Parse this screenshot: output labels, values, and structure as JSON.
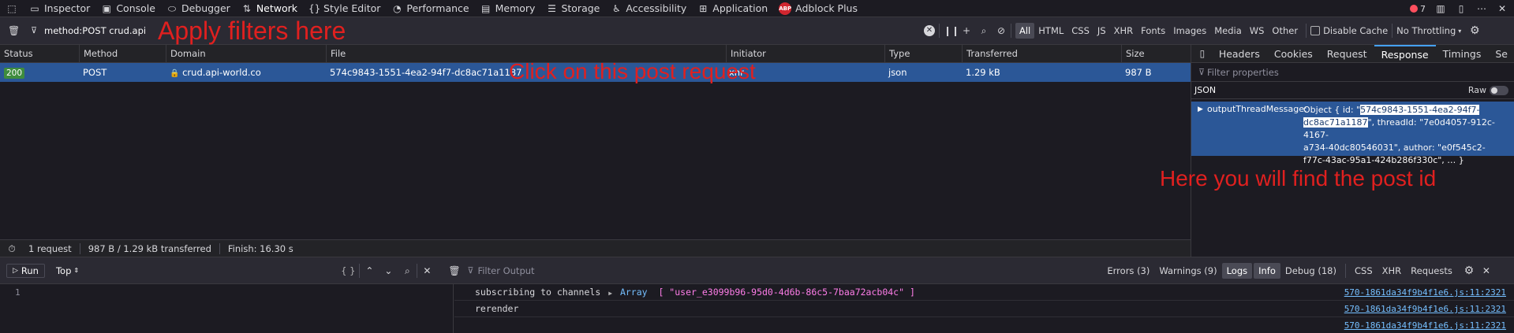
{
  "toolbox": {
    "tabs": [
      {
        "label": "Inspector",
        "icon": "inspector-icon"
      },
      {
        "label": "Console",
        "icon": "console-icon"
      },
      {
        "label": "Debugger",
        "icon": "debugger-icon"
      },
      {
        "label": "Network",
        "icon": "network-icon"
      },
      {
        "label": "Style Editor",
        "icon": "style-editor-icon"
      },
      {
        "label": "Performance",
        "icon": "performance-icon"
      },
      {
        "label": "Memory",
        "icon": "memory-icon"
      },
      {
        "label": "Storage",
        "icon": "storage-icon"
      },
      {
        "label": "Accessibility",
        "icon": "accessibility-icon"
      },
      {
        "label": "Application",
        "icon": "application-icon"
      },
      {
        "label": "Adblock Plus",
        "icon": "adblock-plus-icon"
      }
    ],
    "abp_badge": "ABP",
    "error_count": "7"
  },
  "network": {
    "filter_value": "method:POST crud.api",
    "type_filters": [
      "All",
      "HTML",
      "CSS",
      "JS",
      "XHR",
      "Fonts",
      "Images",
      "Media",
      "WS",
      "Other"
    ],
    "disable_cache_label": "Disable Cache",
    "throttling_label": "No Throttling",
    "columns": [
      "Status",
      "Method",
      "Domain",
      "File",
      "Initiator",
      "Type",
      "Transferred",
      "Size"
    ],
    "request": {
      "status": "200",
      "method": "POST",
      "domain": "crud.api-world.co",
      "file": "574c9843-1551-4ea2-94f7-dc8ac71a1187",
      "initiator": "xhr",
      "type": "json",
      "transferred": "1.29 kB",
      "size": "987 B"
    },
    "summary": {
      "requests": "1 request",
      "transferred": "987 B / 1.29 kB transferred",
      "finish": "Finish: 16.30 s"
    }
  },
  "sidepanel": {
    "tabs": [
      "Headers",
      "Cookies",
      "Request",
      "Response",
      "Timings",
      "Se"
    ],
    "filter_placeholder": "Filter properties",
    "json_label": "JSON",
    "raw_label": "Raw",
    "response": {
      "key": "outputThreadMessage:",
      "line1_pre": "Object { id: \"",
      "id_hl1": "574c9843-1551-4ea2-94f7-",
      "id_hl2": "dc8ac71a1187",
      "line2_post": "\", threadId: \"7e0d4057-912c-4167-",
      "line3": "a734-40dc80546031\", author: \"e0f545c2-",
      "line4": "f77c-43ac-95a1-424b286f330c\", … }"
    }
  },
  "annotations": {
    "filters": "Apply filters here",
    "click": "Click on this post request",
    "postid": "Here you will find the post id"
  },
  "console": {
    "run_label": "Run",
    "context_label": "Top",
    "braces_label": "{ }",
    "filter_placeholder": "Filter Output",
    "levels": [
      {
        "label": "Errors (3)",
        "active": false
      },
      {
        "label": "Warnings (9)",
        "active": false
      },
      {
        "label": "Logs",
        "active": true
      },
      {
        "label": "Info",
        "active": true
      },
      {
        "label": "Debug (18)",
        "active": false
      }
    ],
    "kinds": [
      "CSS",
      "XHR",
      "Requests"
    ],
    "line_number": "1",
    "logs": [
      {
        "text": "subscribing to channels",
        "array_label": "Array",
        "array_value": "[ \"user_e3099b96-95d0-4d6b-86c5-7baa72acb04c\" ]",
        "location": "570-1861da34f9b4f1e6.js:11:2321"
      },
      {
        "text": "rerender",
        "location": "570-1861da34f9b4f1e6.js:11:2321"
      },
      {
        "text": "",
        "location": "570-1861da34f9b4f1e6.js:11:2321"
      }
    ]
  }
}
